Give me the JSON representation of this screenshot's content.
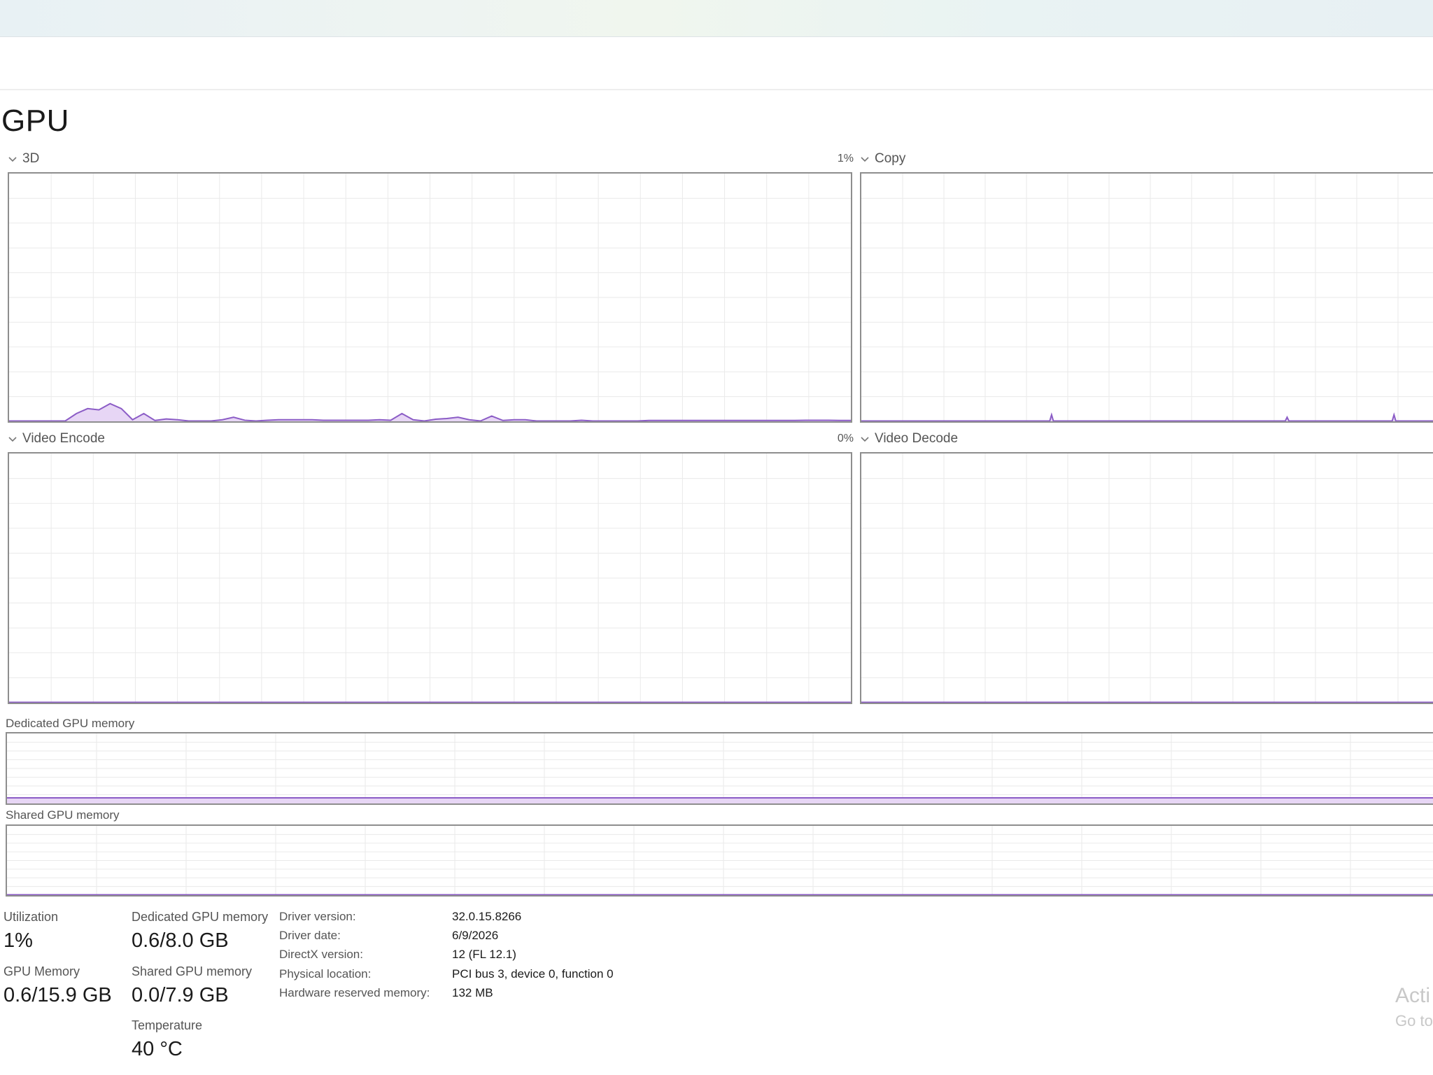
{
  "page": {
    "title": "GPU"
  },
  "colors": {
    "graph_line": "#8b5cc6",
    "graph_fill": "#e7d6f5",
    "graph_border": "#8e8e8e",
    "grid": "#eaeaea"
  },
  "engines": {
    "three_d": {
      "label": "3D",
      "percent": "1%"
    },
    "copy": {
      "label": "Copy"
    },
    "video_encode": {
      "label": "Video Encode",
      "percent": "0%"
    },
    "video_decode": {
      "label": "Video Decode"
    }
  },
  "memory_graphs": {
    "dedicated_label": "Dedicated GPU memory",
    "shared_label": "Shared GPU memory"
  },
  "chart_data": [
    {
      "type": "area",
      "series": [
        {
          "values": [
            0,
            0,
            0,
            0,
            0,
            0,
            3,
            5,
            4.5,
            7,
            5,
            0.5,
            3,
            0.2,
            0.8,
            0.5,
            0,
            0,
            0,
            0.5,
            1.5,
            0.3,
            0,
            0.3,
            0.5,
            0.5,
            0.5,
            0.5,
            0.3,
            0.3,
            0.3,
            0.3,
            0.3,
            0.5,
            0.3,
            3,
            0.5,
            0,
            0.7,
            1,
            1.5,
            0.5,
            0,
            2,
            0.2,
            0.5,
            0.5,
            0,
            0,
            0,
            0,
            0.3,
            0,
            0,
            0,
            0,
            0,
            0.2,
            0.2,
            0.2,
            0.2,
            0.2,
            0.2,
            0.2,
            0.2,
            0.2,
            0.2,
            0.2,
            0.2,
            0.2,
            0.2,
            0.3,
            0.3,
            0.3,
            0.2,
            0.2
          ]
        }
      ],
      "ylim": [
        0,
        100
      ]
    },
    {
      "type": "area",
      "series": [
        {
          "values": [
            0,
            0,
            0,
            0,
            0,
            0,
            0,
            0,
            0,
            0,
            0,
            0,
            0,
            0,
            0,
            0,
            0,
            0,
            0,
            0,
            0,
            0,
            0,
            0,
            0,
            0,
            0,
            0,
            0,
            0,
            0,
            0,
            0,
            0,
            0,
            0,
            0,
            0,
            0,
            0,
            0,
            0,
            0,
            0,
            0,
            0,
            0,
            0,
            0,
            0,
            0,
            0,
            0,
            0,
            0,
            0,
            0,
            0,
            0,
            0,
            0,
            0,
            0,
            0,
            0,
            0,
            0,
            0,
            0,
            0,
            0,
            0,
            0,
            0,
            0,
            0,
            0,
            0,
            0,
            0,
            0,
            0,
            0,
            0,
            0,
            0,
            0,
            0,
            0,
            0,
            0,
            0,
            0,
            0,
            0,
            0,
            0,
            0,
            0,
            0,
            0,
            0,
            0,
            0,
            0,
            2.5,
            0,
            0,
            0,
            0,
            0,
            0,
            0,
            0,
            0,
            0,
            0,
            0,
            0,
            0,
            0,
            0,
            0,
            0,
            0,
            0,
            0,
            0,
            0,
            0,
            0,
            0,
            0,
            0,
            0,
            0,
            0,
            0,
            0,
            0,
            0,
            0,
            0,
            0,
            0,
            0,
            0,
            0,
            0,
            0,
            0,
            0,
            0,
            0,
            0,
            0,
            0,
            0,
            0,
            0,
            0,
            0,
            0,
            0,
            0,
            0,
            0,
            0,
            0,
            0,
            0,
            0,
            0,
            0,
            0,
            0,
            0,
            0,
            0,
            0,
            0,
            0,
            0,
            0,
            0,
            0,
            0,
            0,
            0,
            0,
            0,
            0,
            0,
            0,
            0,
            0,
            0,
            0,
            0,
            0,
            0,
            0,
            0,
            0,
            0,
            0,
            0,
            0,
            0,
            0,
            0,
            0,
            0,
            0,
            0,
            0,
            0,
            0,
            0,
            0,
            0,
            0,
            0,
            0,
            0,
            0,
            0,
            0,
            0,
            0,
            0,
            0,
            0,
            0,
            0,
            1.5,
            0,
            0,
            0,
            0,
            0,
            0,
            0,
            0,
            0,
            0,
            0,
            0,
            0,
            0,
            0,
            0,
            0,
            0,
            0,
            0,
            0,
            0,
            0,
            0,
            0,
            0,
            0,
            0,
            0,
            0,
            0,
            0,
            0,
            0,
            0,
            0,
            0,
            0,
            0,
            0,
            0,
            0,
            0,
            0,
            0,
            0,
            0,
            0,
            0,
            0,
            0,
            0,
            0,
            0,
            0,
            0,
            0,
            0,
            2.5,
            0,
            0,
            0,
            0,
            0,
            0,
            0,
            0,
            0,
            0,
            0,
            0,
            0,
            0,
            0,
            0,
            0,
            0,
            0,
            0,
            0,
            0,
            0,
            0,
            0
          ]
        }
      ],
      "ylim": [
        0,
        100
      ]
    },
    {
      "type": "area",
      "series": [
        {
          "values": [
            0,
            0
          ]
        }
      ],
      "ylim": [
        0,
        100
      ]
    },
    {
      "type": "area",
      "series": [
        {
          "values": [
            0,
            0
          ]
        }
      ],
      "ylim": [
        0,
        100
      ]
    },
    {
      "type": "area",
      "series": [
        {
          "values": [
            7.5,
            7.5,
            7.5,
            7.5,
            7.5,
            7.5,
            7.5,
            7.5,
            7.5,
            7.5,
            7.5,
            7.5,
            7.5,
            7.5,
            7.5,
            7.5,
            7.5,
            7.5,
            7.5,
            7.5,
            7.5,
            7.5,
            7.5,
            7.5,
            7.5,
            7.5,
            7.5,
            7.5,
            7.5,
            7.5,
            7.5,
            7.5,
            7.5,
            7.5,
            7.5,
            7.5,
            7.5,
            7.5,
            7.5,
            7.5,
            7.5,
            7.5,
            7.5,
            7.5,
            7.5,
            7.5
          ]
        }
      ],
      "ylim": [
        0,
        100
      ]
    },
    {
      "type": "area",
      "series": [
        {
          "values": [
            0,
            0
          ]
        }
      ],
      "ylim": [
        0,
        100
      ]
    }
  ],
  "stats": {
    "utilization_label": "Utilization",
    "utilization_value": "1%",
    "dedicated_label": "Dedicated GPU memory",
    "dedicated_value": "0.6/8.0 GB",
    "gpu_memory_label": "GPU Memory",
    "gpu_memory_value": "0.6/15.9 GB",
    "shared_label": "Shared GPU memory",
    "shared_value": "0.0/7.9 GB",
    "temperature_label": "Temperature",
    "temperature_value": "40 °C"
  },
  "info": {
    "driver_version_key": "Driver version:",
    "driver_version_val": "32.0.15.8266",
    "driver_date_key": "Driver date:",
    "driver_date_val": "6/9/2026",
    "directx_key": "DirectX version:",
    "directx_val": "12 (FL 12.1)",
    "physical_key": "Physical location:",
    "physical_val": "PCI bus 3, device 0, function 0",
    "reserved_key": "Hardware reserved memory:",
    "reserved_val": "132 MB"
  },
  "watermark": {
    "line1": "Acti",
    "line2": "Go to"
  }
}
